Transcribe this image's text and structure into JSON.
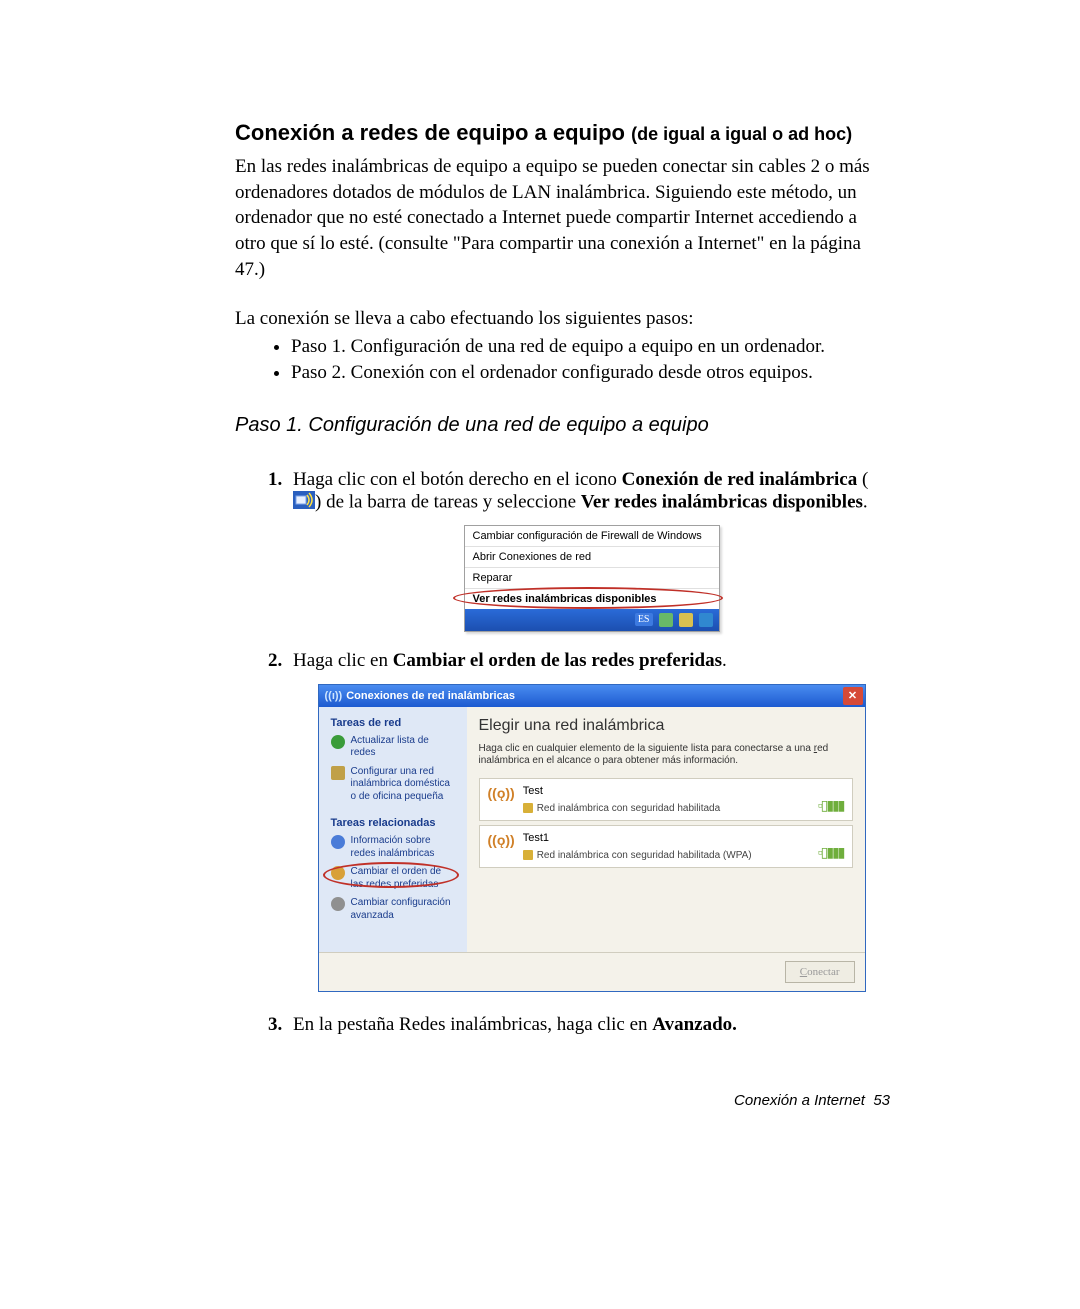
{
  "heading": {
    "main": "Conexión a redes de equipo a equipo ",
    "sub": "(de igual a igual o ad hoc)"
  },
  "intro": "En las redes inalámbricas de equipo a equipo se pueden conectar sin cables 2 o más ordenadores dotados de módulos de LAN inalámbrica. Siguiendo este método, un ordenador que no esté conectado a Internet puede compartir Internet accediendo a otro que sí lo esté. (consulte \"Para compartir una conexión a Internet\" en la página 47.)",
  "lead": "La conexión se lleva a cabo efectuando los siguientes pasos:",
  "bullets": [
    "Paso 1. Configuración de una red de equipo a equipo en un ordenador.",
    "Paso 2. Conexión con el ordenador configurado desde otros equipos."
  ],
  "step_title": "Paso 1. Configuración de una red de equipo a equipo",
  "s1": {
    "pre": "Haga clic con el botón derecho en el icono ",
    "b1": "Conexión de red inalámbrica",
    "mid": " (",
    "post": ") de la barra de tareas y seleccione ",
    "b2": "Ver redes inalámbricas disponibles",
    "end": "."
  },
  "ctx": {
    "i1": "Cambiar configuración de Firewall de Windows",
    "i2": "Abrir Conexiones de red",
    "i3": "Reparar",
    "i4": "Ver redes inalámbricas disponibles",
    "lang": "ES"
  },
  "s2": {
    "pre": "Haga clic en ",
    "b": "Cambiar el orden de las redes preferidas",
    "end": "."
  },
  "dlg": {
    "title": "Conexiones de red inalámbricas",
    "side_h1": "Tareas de red",
    "lnk_refresh": "Actualizar lista de redes",
    "lnk_setup": "Configurar una red inalámbrica doméstica o de oficina pequeña",
    "side_h2": "Tareas relacionadas",
    "lnk_info": "Información sobre redes inalámbricas",
    "lnk_order": "Cambiar el orden de las redes preferidas",
    "lnk_adv": "Cambiar configuración avanzada",
    "main_h": "Elegir una red inalámbrica",
    "hint_a": "Haga clic en cualquier elemento de la siguiente lista para conectarse a una ",
    "hint_u": "r",
    "hint_b": "ed inalámbrica en el alcance o para obtener más información.",
    "n1": {
      "name": "Test",
      "desc": "Red inalámbrica con seguridad habilitada"
    },
    "n2": {
      "name": "Test1",
      "desc": "Red inalámbrica con seguridad habilitada (WPA)"
    },
    "connect_u": "C",
    "connect_rest": "onectar"
  },
  "s3": {
    "pre": "En la pestaña Redes inalámbricas, haga clic en ",
    "b": "Avanzado.",
    "end": ""
  },
  "footer": {
    "label": "Conexión a Internet",
    "page": "53"
  }
}
